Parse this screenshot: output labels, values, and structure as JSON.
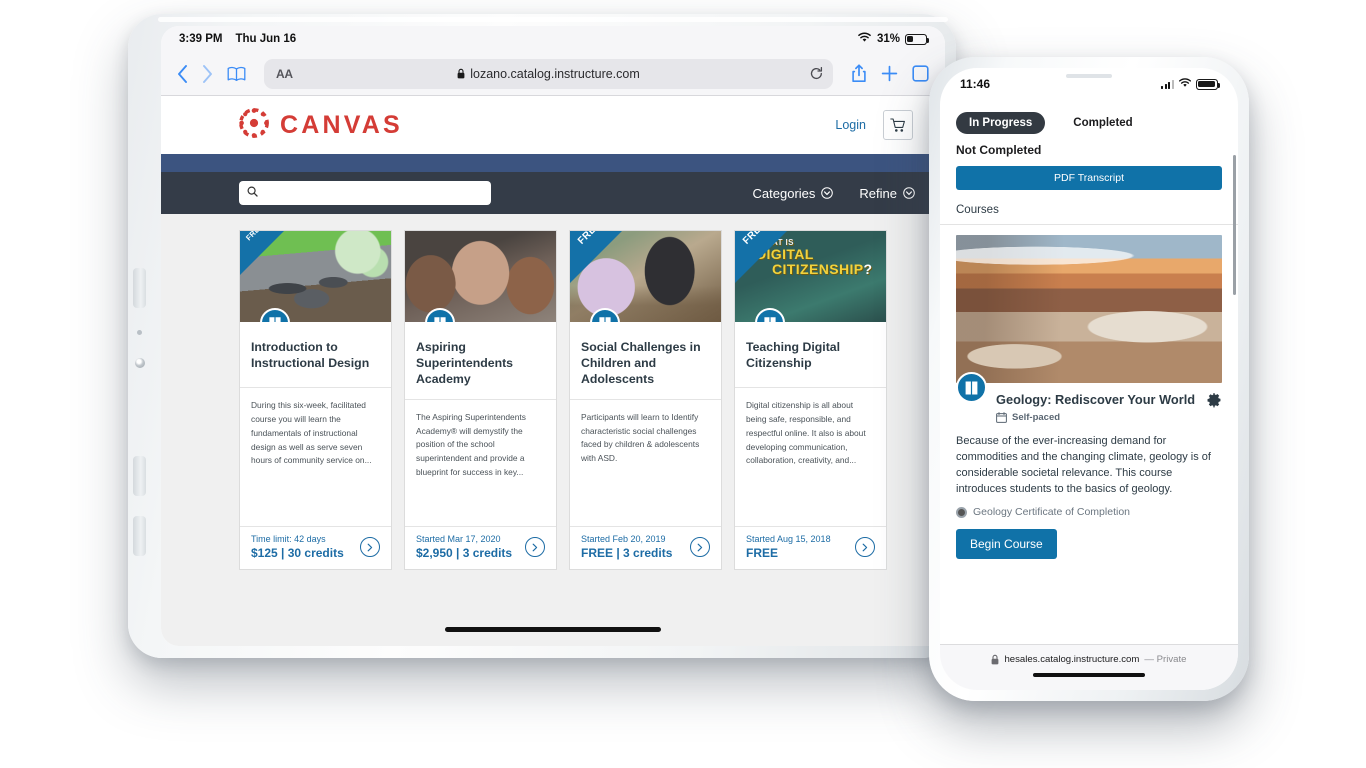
{
  "tablet": {
    "status_bar": {
      "time": "3:39 PM",
      "date": "Thu Jun 16",
      "battery_percent": "31%"
    },
    "browser": {
      "text_size_label": "AA",
      "url": "lozano.catalog.instructure.com",
      "back_icon": "chevron-left-icon",
      "forward_icon": "chevron-right-icon",
      "bookmarks_icon": "book-icon",
      "reload_icon": "reload-icon",
      "share_icon": "share-icon",
      "new_tab_icon": "plus-icon"
    },
    "page": {
      "brand": "CANVAS",
      "login_label": "Login",
      "cart_icon": "shopping-cart-icon",
      "search_placeholder": "",
      "search_value": "",
      "categories_label": "Categories",
      "refine_label": "Refine",
      "cards": [
        {
          "ribbon": "FREE",
          "ribbon_visible": true,
          "ribbon_small": true,
          "title": "Introduction to Instructional Design",
          "description": "During this six-week, facilitated course you will learn the fundamentals of instructional design as well as serve seven hours of community service on...",
          "date": "Time limit: 42 days",
          "price": "$125 | 30 credits"
        },
        {
          "ribbon": "",
          "ribbon_visible": false,
          "ribbon_small": true,
          "title": "Aspiring Superintendents Academy",
          "description": "The Aspiring Superintendents Academy® will demystify the position of the school superintendent and provide a blueprint for success in key...",
          "date": "Started Mar 17, 2020",
          "price": "$2,950 | 3 credits"
        },
        {
          "ribbon": "FREE",
          "ribbon_visible": true,
          "ribbon_small": false,
          "title": "Social Challenges in Children and Adolescents",
          "description": "Participants will learn to Identify characteristic social challenges faced by children & adolescents with ASD.",
          "date": "Started Feb 20, 2019",
          "price": "FREE | 3 credits"
        },
        {
          "ribbon": "FREE",
          "ribbon_visible": true,
          "ribbon_small": false,
          "title": "Teaching Digital Citizenship",
          "description": "Digital citizenship is all about being safe, responsible, and respectful online. It also is about developing communication, collaboration, creativity, and...",
          "date": "Started Aug 15, 2018",
          "price": "FREE",
          "art_text": {
            "line1": "AT IS",
            "line2": "DIGITAL",
            "line3": "CITIZENSHIP",
            "mark": "?"
          }
        }
      ]
    }
  },
  "phone": {
    "status_bar": {
      "time": "11:46",
      "signal_icon": "cellular-bars-icon",
      "wifi_icon": "wifi-icon",
      "battery_icon": "battery-icon"
    },
    "tabs": [
      {
        "label": "In Progress",
        "active": true
      },
      {
        "label": "Completed",
        "active": false
      }
    ],
    "not_completed_label": "Not Completed",
    "pdf_transcript_label": "PDF Transcript",
    "courses_heading": "Courses",
    "course": {
      "title": "Geology: Rediscover Your World",
      "pace_label": "Self-paced",
      "pace_icon": "calendar-icon",
      "settings_icon": "gear-icon",
      "description": "Because of the ever-increasing demand for commodities and the changing climate, geology is of considerable societal relevance. This course introduces students to the basics of geology.",
      "certificate_label": "Geology Certificate of Completion",
      "begin_label": "Begin Course"
    },
    "browser_bottom": {
      "url": "hesales.catalog.instructure.com",
      "mode": "— Private",
      "lock_icon": "lock-icon"
    }
  },
  "colors": {
    "canvas_red": "#d43c36",
    "canvas_blue": "#1072a8",
    "nav_navy": "#3c5480",
    "search_bar": "#343c48",
    "link_blue": "#1d6ca5"
  }
}
